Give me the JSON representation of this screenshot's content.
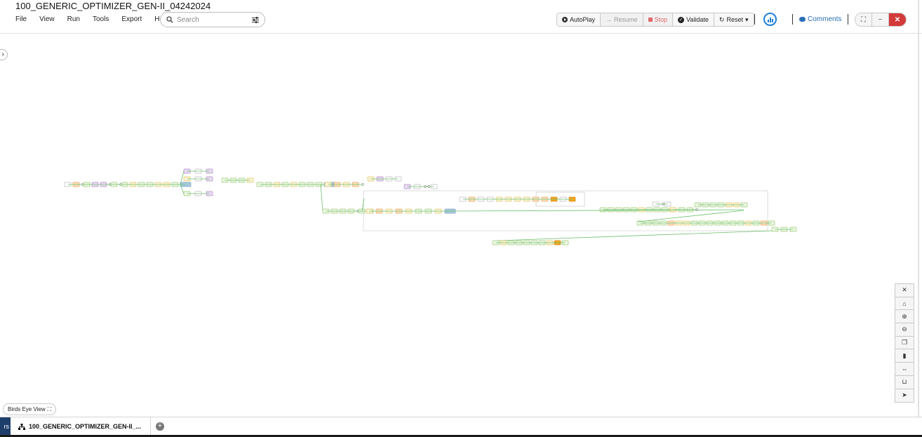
{
  "title": "100_GENERIC_OPTIMIZER_GEN-II_04242024",
  "menu": [
    "File",
    "View",
    "Run",
    "Tools",
    "Export",
    "Help"
  ],
  "search": {
    "placeholder": "Search"
  },
  "controls": {
    "autoplay": "AutoPlay",
    "resume": "Resume",
    "stop": "Stop",
    "validate": "Validate",
    "reset": "Reset"
  },
  "comments": "Comments",
  "birds_eye": "Birds Eye View",
  "bottom": {
    "left_tab": "rs",
    "active_tab": "100_GENERIC_OPTIMIZER_GEN-II_..."
  },
  "toolbar_icons": [
    "collapse-icon",
    "home-icon",
    "zoom-in-icon",
    "zoom-out-icon",
    "layers-icon",
    "bar-chart-icon",
    "fit-width-icon",
    "basket-icon",
    "pointer-icon"
  ],
  "colors": {
    "accent": "#1e7fd8",
    "close": "#d33a3a",
    "stop": "#e06a6a",
    "edge": "#6cbf6c"
  }
}
